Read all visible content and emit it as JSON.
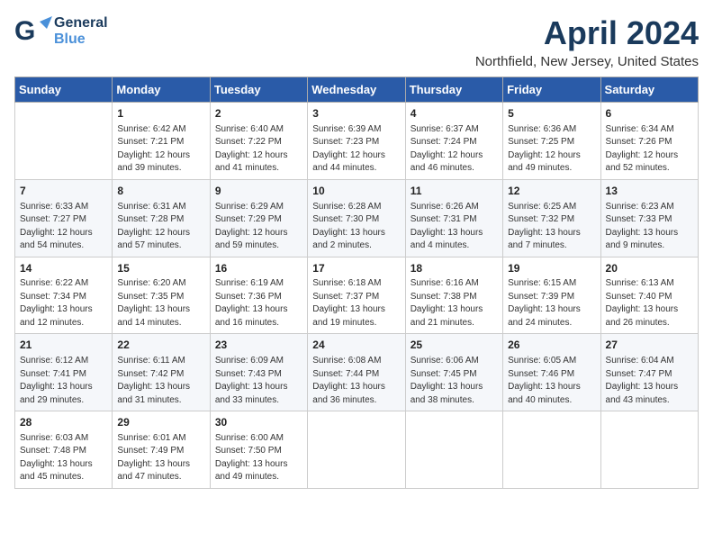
{
  "logo": {
    "line1": "General",
    "line2": "Blue"
  },
  "title": "April 2024",
  "subtitle": "Northfield, New Jersey, United States",
  "days_of_week": [
    "Sunday",
    "Monday",
    "Tuesday",
    "Wednesday",
    "Thursday",
    "Friday",
    "Saturday"
  ],
  "weeks": [
    [
      {
        "day": "",
        "content": ""
      },
      {
        "day": "1",
        "content": "Sunrise: 6:42 AM\nSunset: 7:21 PM\nDaylight: 12 hours\nand 39 minutes."
      },
      {
        "day": "2",
        "content": "Sunrise: 6:40 AM\nSunset: 7:22 PM\nDaylight: 12 hours\nand 41 minutes."
      },
      {
        "day": "3",
        "content": "Sunrise: 6:39 AM\nSunset: 7:23 PM\nDaylight: 12 hours\nand 44 minutes."
      },
      {
        "day": "4",
        "content": "Sunrise: 6:37 AM\nSunset: 7:24 PM\nDaylight: 12 hours\nand 46 minutes."
      },
      {
        "day": "5",
        "content": "Sunrise: 6:36 AM\nSunset: 7:25 PM\nDaylight: 12 hours\nand 49 minutes."
      },
      {
        "day": "6",
        "content": "Sunrise: 6:34 AM\nSunset: 7:26 PM\nDaylight: 12 hours\nand 52 minutes."
      }
    ],
    [
      {
        "day": "7",
        "content": "Sunrise: 6:33 AM\nSunset: 7:27 PM\nDaylight: 12 hours\nand 54 minutes."
      },
      {
        "day": "8",
        "content": "Sunrise: 6:31 AM\nSunset: 7:28 PM\nDaylight: 12 hours\nand 57 minutes."
      },
      {
        "day": "9",
        "content": "Sunrise: 6:29 AM\nSunset: 7:29 PM\nDaylight: 12 hours\nand 59 minutes."
      },
      {
        "day": "10",
        "content": "Sunrise: 6:28 AM\nSunset: 7:30 PM\nDaylight: 13 hours\nand 2 minutes."
      },
      {
        "day": "11",
        "content": "Sunrise: 6:26 AM\nSunset: 7:31 PM\nDaylight: 13 hours\nand 4 minutes."
      },
      {
        "day": "12",
        "content": "Sunrise: 6:25 AM\nSunset: 7:32 PM\nDaylight: 13 hours\nand 7 minutes."
      },
      {
        "day": "13",
        "content": "Sunrise: 6:23 AM\nSunset: 7:33 PM\nDaylight: 13 hours\nand 9 minutes."
      }
    ],
    [
      {
        "day": "14",
        "content": "Sunrise: 6:22 AM\nSunset: 7:34 PM\nDaylight: 13 hours\nand 12 minutes."
      },
      {
        "day": "15",
        "content": "Sunrise: 6:20 AM\nSunset: 7:35 PM\nDaylight: 13 hours\nand 14 minutes."
      },
      {
        "day": "16",
        "content": "Sunrise: 6:19 AM\nSunset: 7:36 PM\nDaylight: 13 hours\nand 16 minutes."
      },
      {
        "day": "17",
        "content": "Sunrise: 6:18 AM\nSunset: 7:37 PM\nDaylight: 13 hours\nand 19 minutes."
      },
      {
        "day": "18",
        "content": "Sunrise: 6:16 AM\nSunset: 7:38 PM\nDaylight: 13 hours\nand 21 minutes."
      },
      {
        "day": "19",
        "content": "Sunrise: 6:15 AM\nSunset: 7:39 PM\nDaylight: 13 hours\nand 24 minutes."
      },
      {
        "day": "20",
        "content": "Sunrise: 6:13 AM\nSunset: 7:40 PM\nDaylight: 13 hours\nand 26 minutes."
      }
    ],
    [
      {
        "day": "21",
        "content": "Sunrise: 6:12 AM\nSunset: 7:41 PM\nDaylight: 13 hours\nand 29 minutes."
      },
      {
        "day": "22",
        "content": "Sunrise: 6:11 AM\nSunset: 7:42 PM\nDaylight: 13 hours\nand 31 minutes."
      },
      {
        "day": "23",
        "content": "Sunrise: 6:09 AM\nSunset: 7:43 PM\nDaylight: 13 hours\nand 33 minutes."
      },
      {
        "day": "24",
        "content": "Sunrise: 6:08 AM\nSunset: 7:44 PM\nDaylight: 13 hours\nand 36 minutes."
      },
      {
        "day": "25",
        "content": "Sunrise: 6:06 AM\nSunset: 7:45 PM\nDaylight: 13 hours\nand 38 minutes."
      },
      {
        "day": "26",
        "content": "Sunrise: 6:05 AM\nSunset: 7:46 PM\nDaylight: 13 hours\nand 40 minutes."
      },
      {
        "day": "27",
        "content": "Sunrise: 6:04 AM\nSunset: 7:47 PM\nDaylight: 13 hours\nand 43 minutes."
      }
    ],
    [
      {
        "day": "28",
        "content": "Sunrise: 6:03 AM\nSunset: 7:48 PM\nDaylight: 13 hours\nand 45 minutes."
      },
      {
        "day": "29",
        "content": "Sunrise: 6:01 AM\nSunset: 7:49 PM\nDaylight: 13 hours\nand 47 minutes."
      },
      {
        "day": "30",
        "content": "Sunrise: 6:00 AM\nSunset: 7:50 PM\nDaylight: 13 hours\nand 49 minutes."
      },
      {
        "day": "",
        "content": ""
      },
      {
        "day": "",
        "content": ""
      },
      {
        "day": "",
        "content": ""
      },
      {
        "day": "",
        "content": ""
      }
    ]
  ]
}
